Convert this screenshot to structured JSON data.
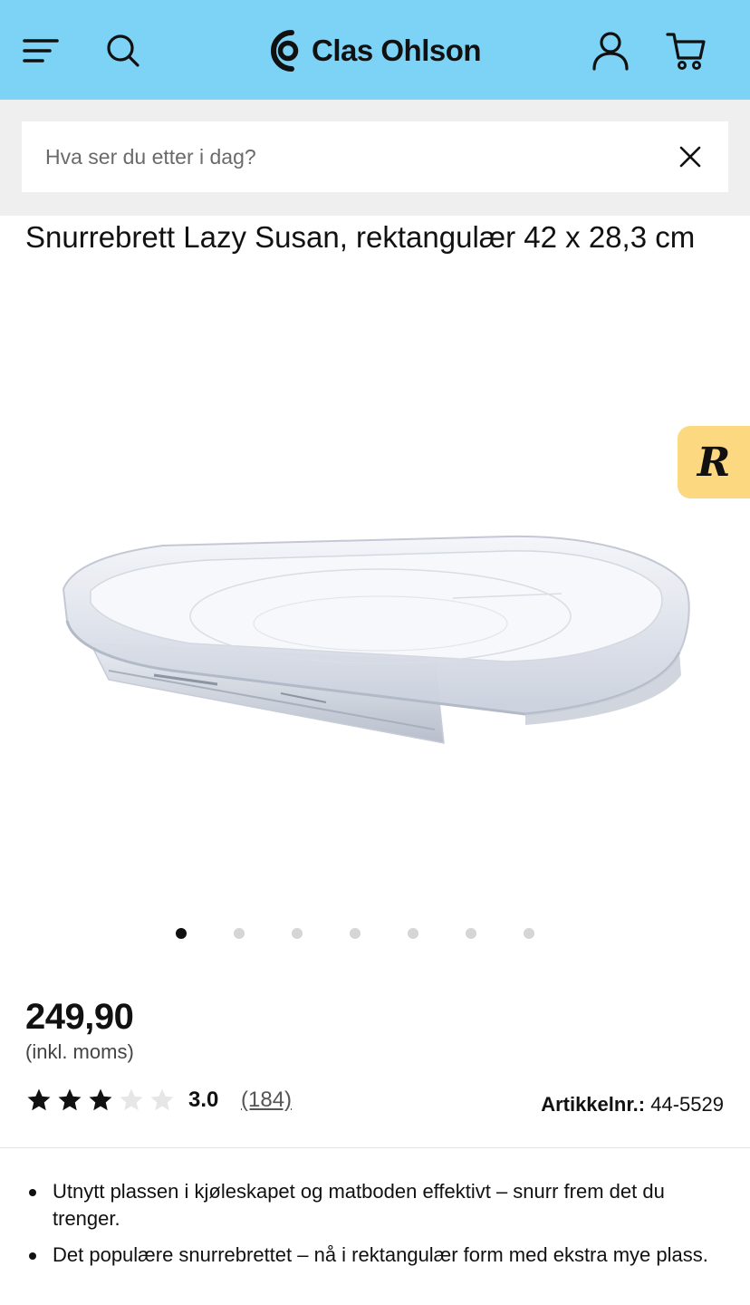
{
  "header": {
    "brand": "Clas Ohlson",
    "menu_icon": "menu-icon",
    "search_icon": "search-icon",
    "account_icon": "user-icon",
    "cart_icon": "cart-icon",
    "background_color": "#7dd3f6"
  },
  "search": {
    "placeholder": "Hva ser du etter i dag?",
    "value": "",
    "clear_icon": "close-icon"
  },
  "product": {
    "title": "Snurrebrett Lazy Susan, rektangulær 42 x 28,3 cm",
    "image_count": 7,
    "active_image": 1,
    "price": "249,90",
    "vat_note": "(inkl. moms)",
    "rating": {
      "value": "3.0",
      "count": "(184)",
      "stars_filled": 3,
      "stars_total": 5
    },
    "article_label": "Artikkelnr.:",
    "article_number": "44-5529",
    "bullets": [
      "Utnytt plassen i kjøleskapet og matboden effektivt – snurr frem det du trenger.",
      "Det populære snurrebrettet – nå i rektangulær form med ekstra mye plass."
    ]
  },
  "side_badge": {
    "letter": "R",
    "color": "#fcd880"
  }
}
